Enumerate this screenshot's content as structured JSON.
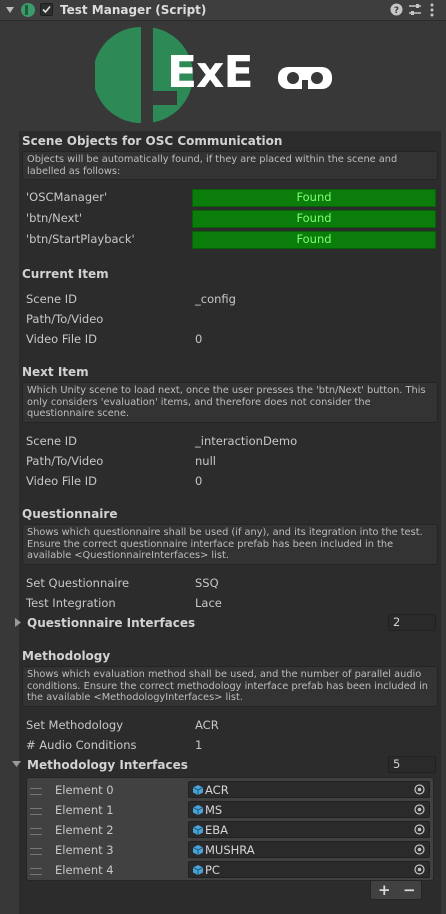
{
  "header": {
    "title": "Test Manager (Script)"
  },
  "logo": {
    "text": "ExE"
  },
  "scene_objects": {
    "title": "Scene Objects for OSC Communication",
    "help": "Objects will be automatically found, if they are placed within the scene and labelled as follows:",
    "rows": [
      {
        "label": "'OSCManager'",
        "status": "Found"
      },
      {
        "label": "'btn/Next'",
        "status": "Found"
      },
      {
        "label": "'btn/StartPlayback'",
        "status": "Found"
      }
    ]
  },
  "current_item": {
    "title": "Current Item",
    "rows": [
      {
        "label": "Scene ID",
        "value": "_config"
      },
      {
        "label": "Path/To/Video",
        "value": ""
      },
      {
        "label": "Video File ID",
        "value": "0"
      }
    ]
  },
  "next_item": {
    "title": "Next Item",
    "help": "Which Unity scene to load next, once the user presses the 'btn/Next' button. This only considers 'evaluation' items, and therefore does not consider the questionnaire scene.",
    "rows": [
      {
        "label": "Scene ID",
        "value": "_interactionDemo"
      },
      {
        "label": "Path/To/Video",
        "value": "null"
      },
      {
        "label": "Video File ID",
        "value": "0"
      }
    ]
  },
  "questionnaire": {
    "title": "Questionnaire",
    "help": "Shows which questionnaire shall be used (if any), and its itegration into the test. Ensure the correct questionnaire interface prefab has been included in the available <QuestionnaireInterfaces> list.",
    "rows": [
      {
        "label": "Set Questionnaire",
        "value": "SSQ"
      },
      {
        "label": "Test Integration",
        "value": "Lace"
      }
    ],
    "interfaces_label": "Questionnaire Interfaces",
    "interfaces_count": "2"
  },
  "methodology": {
    "title": "Methodology",
    "help": "Shows which evaluation method shall be used, and the number of parallel audio conditions. Ensure the correct methodology interface prefab has been included in the available <MethodologyInterfaces> list.",
    "rows": [
      {
        "label": "Set Methodology",
        "value": "ACR"
      },
      {
        "label": "# Audio Conditions",
        "value": "1"
      }
    ],
    "interfaces_label": "Methodology Interfaces",
    "interfaces_count": "5",
    "elements": [
      {
        "label": "Element 0",
        "value": "ACR"
      },
      {
        "label": "Element 1",
        "value": "MS"
      },
      {
        "label": "Element 2",
        "value": "EBA"
      },
      {
        "label": "Element 3",
        "value": "MUSHRA"
      },
      {
        "label": "Element 4",
        "value": "PC"
      }
    ],
    "add_label": "+",
    "remove_label": "−"
  },
  "colors": {
    "accent_green": "#0b7d0b",
    "logo_green": "#2d8a57",
    "found_text": "#7dff72"
  }
}
